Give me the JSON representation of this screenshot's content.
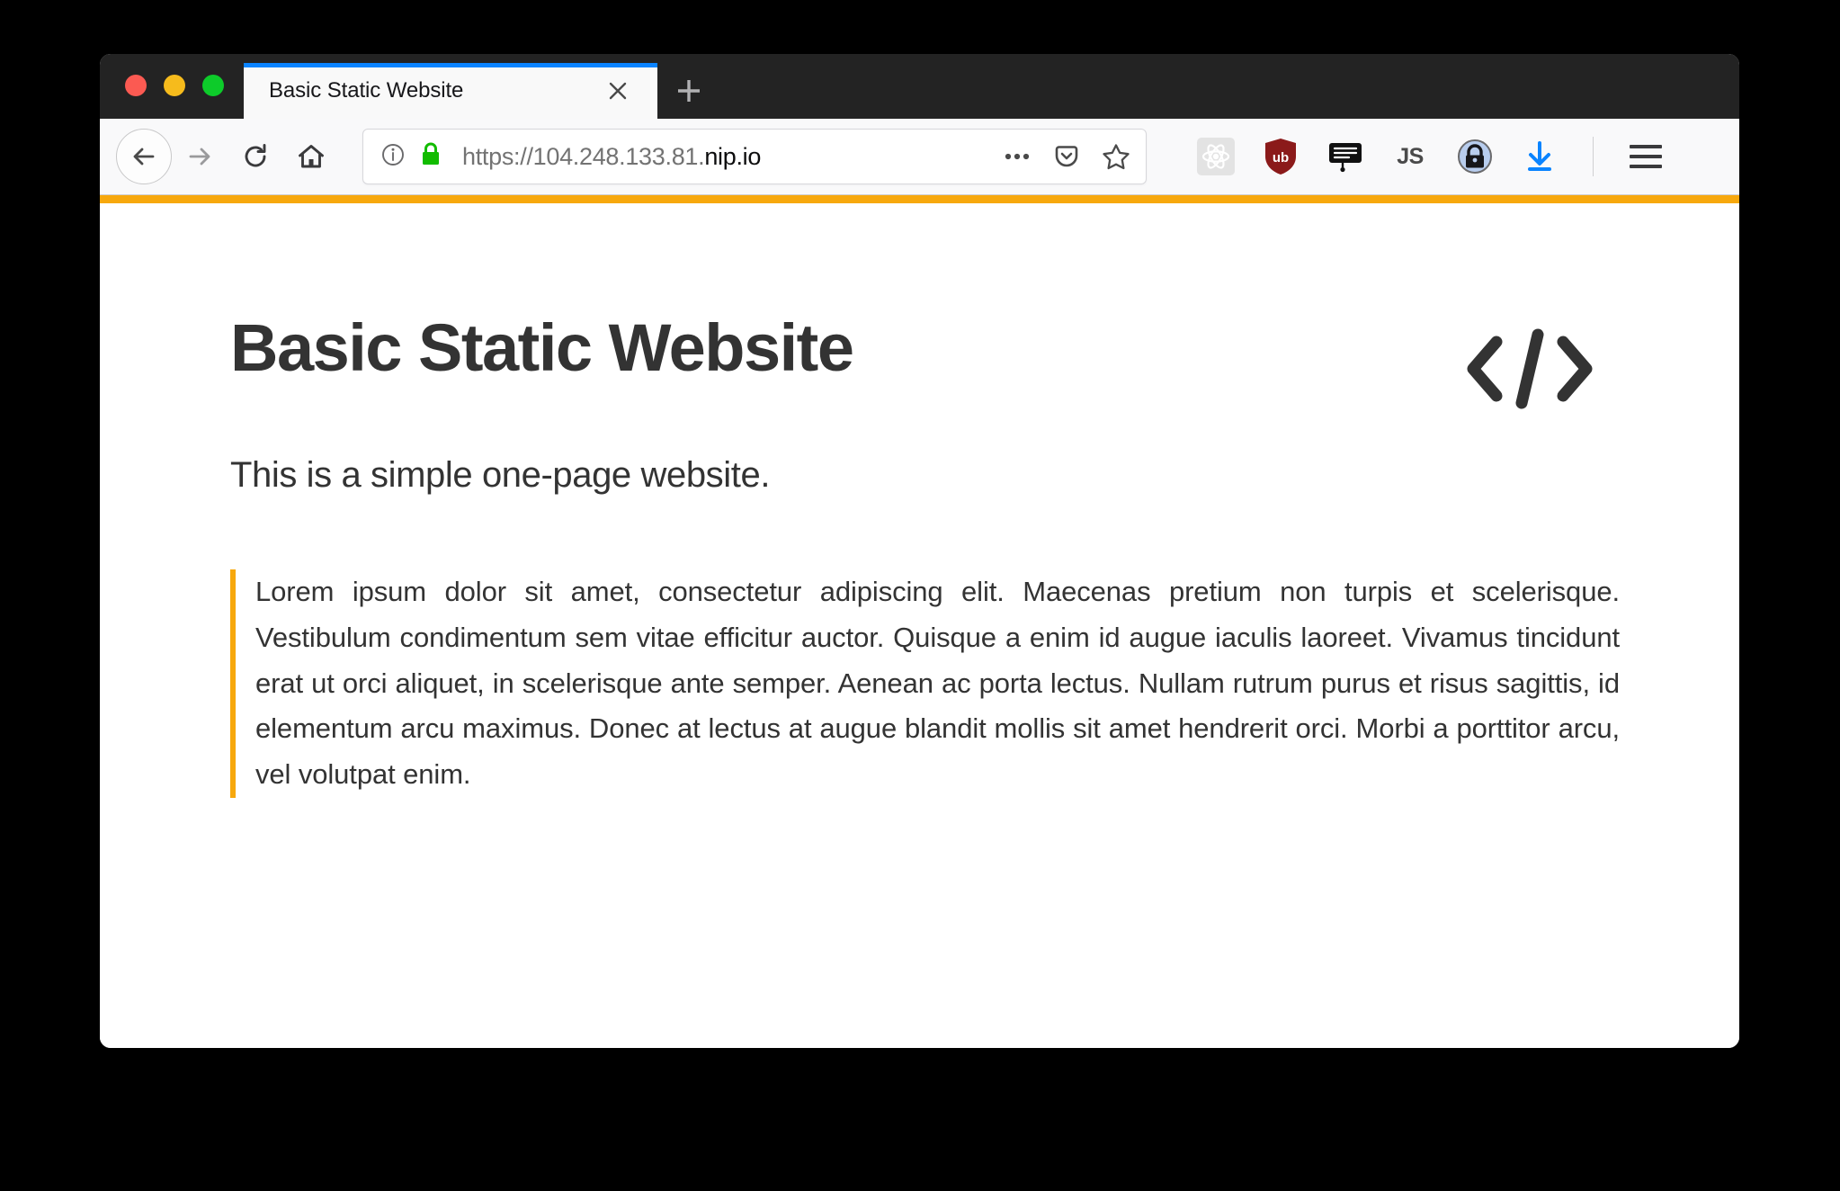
{
  "window": {
    "traffic_lights": [
      {
        "name": "close",
        "color": "#fb5a52"
      },
      {
        "name": "minimize",
        "color": "#f6bb1c"
      },
      {
        "name": "maximize",
        "color": "#0dcb2a"
      }
    ]
  },
  "tabs": [
    {
      "title": "Basic Static Website",
      "active": true,
      "close_icon": "close-icon"
    }
  ],
  "new_tab": {
    "icon": "plus-icon",
    "label": "+"
  },
  "toolbar": {
    "back": {
      "icon": "back-arrow-icon"
    },
    "forward": {
      "icon": "forward-arrow-icon"
    },
    "reload": {
      "icon": "reload-icon"
    },
    "home": {
      "icon": "home-icon"
    }
  },
  "urlbar": {
    "info_icon": "info-icon",
    "lock_icon": "padlock-icon",
    "url_prefix": "https://104.248.133.81.",
    "url_domain": "nip.io",
    "full_url": "https://104.248.133.81.nip.io",
    "actions": [
      {
        "name": "page-actions-icon",
        "glyph": "…"
      },
      {
        "name": "pocket-icon"
      },
      {
        "name": "bookmark-star-icon"
      }
    ]
  },
  "extensions": [
    {
      "name": "react-devtools-icon",
      "label": "React DevTools"
    },
    {
      "name": "ublock-origin-icon",
      "label": "uBlock Origin",
      "badge_text": "ub",
      "color": "#8b1a1a"
    },
    {
      "name": "notes-icon",
      "label": "Notes"
    },
    {
      "name": "javascript-toggle-icon",
      "label": "JS"
    },
    {
      "name": "privacy-lock-icon",
      "label": "Privacy Badger"
    },
    {
      "name": "downloads-icon",
      "label": "Downloads",
      "color": "#0a84ff"
    }
  ],
  "menu": {
    "name": "hamburger-menu-icon",
    "label": "Open menu"
  },
  "accent_color": "#f7a80d",
  "page": {
    "title": "Basic Static Website",
    "code_icon": "code-brackets-icon",
    "subtitle": "This is a simple one-page website.",
    "blockquote": "Lorem ipsum dolor sit amet, consectetur adipiscing elit. Maecenas pretium non turpis et scelerisque. Vestibulum condimentum sem vitae efficitur auctor. Quisque a enim id augue iaculis laoreet. Vivamus tincidunt erat ut orci aliquet, in scelerisque ante semper. Aenean ac porta lectus. Nullam rutrum purus et risus sagittis, id elementum arcu maximus. Donec at lectus at augue blandit mollis sit amet hendrerit orci. Morbi a porttitor arcu, vel volutpat enim."
  }
}
